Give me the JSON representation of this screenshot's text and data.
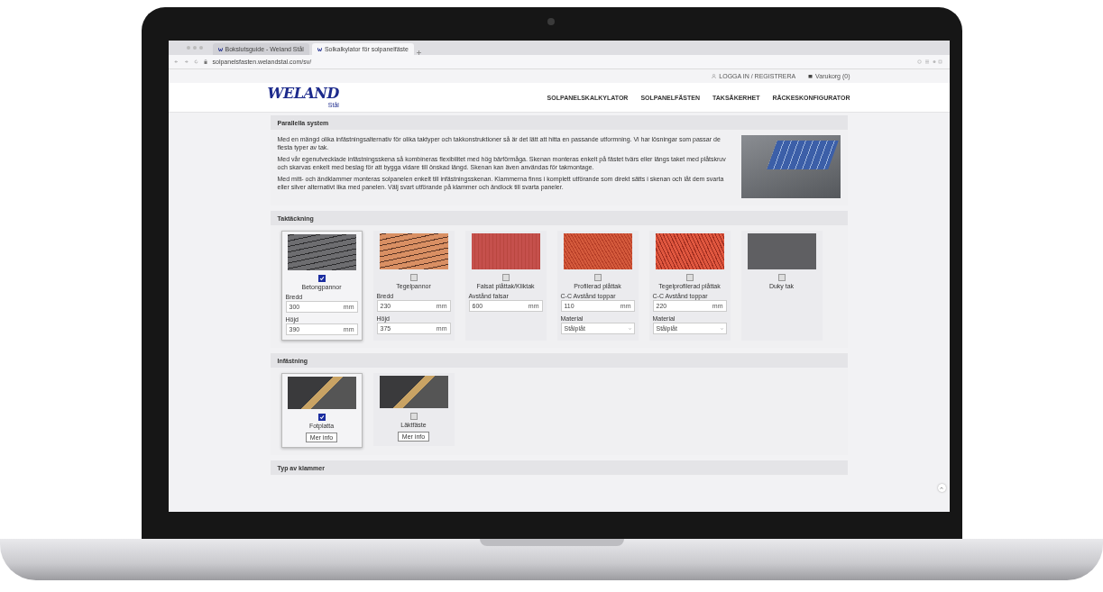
{
  "browser": {
    "tabs": [
      {
        "title": "Bokslutsguide - Weland Stål",
        "selected": false
      },
      {
        "title": "Solkalkylator för solpanelfäste",
        "selected": true
      }
    ],
    "url": "solpanelsfasten.welandstal.com/sv/"
  },
  "header": {
    "logo": "WELAND",
    "logo_sub": "Stål",
    "login": "LOGGA IN / REGISTRERA",
    "cart": "Varukorg (0)",
    "nav": [
      "SOLPANELSKALKYLATOR",
      "SOLPANELFÄSTEN",
      "TAKSÄKERHET",
      "RÄCKESKONFIGURATOR"
    ]
  },
  "intro": {
    "title": "Parallella system",
    "paragraphs": [
      "Med en mängd olika infästningsalternativ för olika taktyper och takkonstruktioner så är det lätt att hitta en passande utformning. Vi har lösningar som passar de flesta typer av tak.",
      "Med vår egenutvecklade infästningsskena så kombineras flexibilitet med hög bärförmåga. Skenan monteras enkelt på fästet tvärs eller längs taket med plåtskruv och skarvas enkelt med beslag för att bygga vidare till önskad längd. Skenan kan även användas för takmontage.",
      "Med mitt- och ändklammer monteras solpanelen enkelt till infästningsskenan. Klammerna finns i komplett utförande som direkt sätts i skenan och låt dem svarta eller silver alternativt lika med panelen. Välj svart utförande på klammer och ändlock till svarta paneler."
    ]
  },
  "roofing": {
    "title": "Taktäckning",
    "options": [
      {
        "kind": "concrete",
        "label": "Betongpannor",
        "checked": true,
        "fields": [
          {
            "kind": "input",
            "label": "Bredd",
            "value": "300",
            "unit": "mm"
          },
          {
            "kind": "input",
            "label": "Höjd",
            "value": "390",
            "unit": "mm"
          }
        ]
      },
      {
        "kind": "tile",
        "label": "Tegelpannor",
        "checked": false,
        "fields": [
          {
            "kind": "input",
            "label": "Bredd",
            "value": "230",
            "unit": "mm"
          },
          {
            "kind": "input",
            "label": "Höjd",
            "value": "375",
            "unit": "mm"
          }
        ]
      },
      {
        "kind": "seam",
        "label": "Falsat plåttak/Kliktak",
        "checked": false,
        "fields": [
          {
            "kind": "input",
            "label": "Avstånd falsar",
            "value": "600",
            "unit": "mm"
          }
        ]
      },
      {
        "kind": "corrugated",
        "label": "Profilerad plåttak",
        "checked": false,
        "fields": [
          {
            "kind": "input",
            "label": "C-C Avstånd toppar",
            "value": "110",
            "unit": "mm"
          },
          {
            "kind": "select",
            "label": "Material",
            "value": "Stålplåt"
          }
        ]
      },
      {
        "kind": "tilesheet",
        "label": "Tegelprofilerad plåttak",
        "checked": false,
        "fields": [
          {
            "kind": "input",
            "label": "C-C Avstånd toppar",
            "value": "220",
            "unit": "mm"
          },
          {
            "kind": "select",
            "label": "Material",
            "value": "Stålplåt"
          }
        ]
      },
      {
        "kind": "flat",
        "label": "Duky tak",
        "checked": false
      }
    ]
  },
  "mounting": {
    "title": "Infästning",
    "options": [
      {
        "label": "Fotplatta",
        "checked": true,
        "button": "Mer info"
      },
      {
        "label": "Läktfäste",
        "checked": false,
        "button": "Mer info"
      }
    ]
  },
  "next_section": {
    "title": "Typ av klammer"
  }
}
